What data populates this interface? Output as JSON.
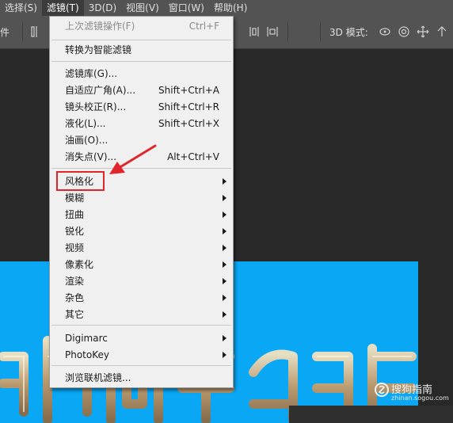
{
  "menubar": {
    "items": [
      {
        "label": "选择(S)"
      },
      {
        "label": "滤镜(T)",
        "active": true
      },
      {
        "label": "3D(D)"
      },
      {
        "label": "视图(V)"
      },
      {
        "label": "窗口(W)"
      },
      {
        "label": "帮助(H)"
      }
    ]
  },
  "optionsbar": {
    "left_label": "件",
    "mode_label": "3D 模式:"
  },
  "filter_menu": {
    "items": [
      {
        "label": "上次滤镜操作(F)",
        "shortcut": "Ctrl+F",
        "disabled": true
      },
      {
        "label": "转换为智能滤镜"
      },
      {
        "label": "滤镜库(G)..."
      },
      {
        "label": "自适应广角(A)...",
        "shortcut": "Shift+Ctrl+A"
      },
      {
        "label": "镜头校正(R)...",
        "shortcut": "Shift+Ctrl+R"
      },
      {
        "label": "液化(L)...",
        "shortcut": "Shift+Ctrl+X"
      },
      {
        "label": "油画(O)..."
      },
      {
        "label": "消失点(V)...",
        "shortcut": "Alt+Ctrl+V"
      },
      {
        "label": "风格化",
        "submenu": true,
        "highlighted": true
      },
      {
        "label": "模糊",
        "submenu": true
      },
      {
        "label": "扭曲",
        "submenu": true
      },
      {
        "label": "锐化",
        "submenu": true
      },
      {
        "label": "视频",
        "submenu": true
      },
      {
        "label": "像素化",
        "submenu": true
      },
      {
        "label": "渲染",
        "submenu": true
      },
      {
        "label": "杂色",
        "submenu": true
      },
      {
        "label": "其它",
        "submenu": true
      },
      {
        "label": "Digimarc",
        "submenu": true
      },
      {
        "label": "PhotoKey",
        "submenu": true
      },
      {
        "label": "浏览联机滤镜..."
      }
    ]
  },
  "watermark": {
    "text": "搜狗指南",
    "sub": "zhinan.sogou.com"
  },
  "colors": {
    "menubar_bg": "#535353",
    "workspace_bg": "#282828",
    "canvas_bg": "#0aa7f5",
    "menu_bg": "#f0f0f0",
    "annotation_red": "#e0262a"
  },
  "icons": [
    "align-icon",
    "distribute-icon",
    "3d-rotate-icon",
    "3d-roll-icon",
    "3d-pan-icon",
    "3d-slide-icon",
    "3d-scale-icon"
  ]
}
